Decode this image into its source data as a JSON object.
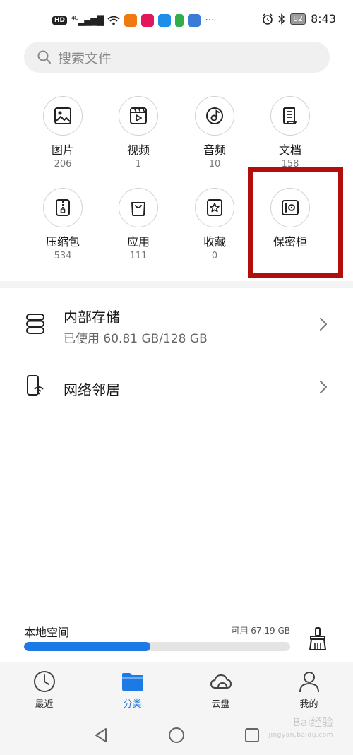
{
  "status_bar": {
    "hd": "HD",
    "network": "4G",
    "battery": "82",
    "time": "8:43",
    "more": "···"
  },
  "search": {
    "placeholder": "搜索文件",
    "icon": "search-icon"
  },
  "categories": [
    {
      "label": "图片",
      "count": "206",
      "icon": "image-icon"
    },
    {
      "label": "视频",
      "count": "1",
      "icon": "video-icon"
    },
    {
      "label": "音频",
      "count": "10",
      "icon": "audio-icon"
    },
    {
      "label": "文档",
      "count": "158",
      "icon": "document-icon"
    },
    {
      "label": "压缩包",
      "count": "534",
      "icon": "archive-icon"
    },
    {
      "label": "应用",
      "count": "111",
      "icon": "app-bag-icon"
    },
    {
      "label": "收藏",
      "count": "0",
      "icon": "favorite-star-icon"
    },
    {
      "label": "保密柜",
      "count": "",
      "icon": "safe-icon"
    }
  ],
  "storage": {
    "internal": {
      "title": "内部存储",
      "subtitle": "已使用 60.81 GB/128 GB",
      "icon": "storage-icon"
    },
    "network": {
      "title": "网络邻居",
      "icon": "network-neighbor-icon"
    }
  },
  "local_space": {
    "title": "本地空间",
    "available": "可用 67.19 GB",
    "used_fraction": 0.475,
    "bar_color": "#1b7ae6"
  },
  "bottom_nav": [
    {
      "label": "最近",
      "icon": "clock-icon",
      "active": false
    },
    {
      "label": "分类",
      "icon": "folder-icon",
      "active": true
    },
    {
      "label": "云盘",
      "icon": "cloud-icon",
      "active": false
    },
    {
      "label": "我的",
      "icon": "person-icon",
      "active": false
    }
  ],
  "watermark": {
    "text": "Bai经验",
    "sub": "jingyan.baidu.com"
  },
  "colors": {
    "accent": "#1b7ae6",
    "highlight": "#b20e0e"
  }
}
